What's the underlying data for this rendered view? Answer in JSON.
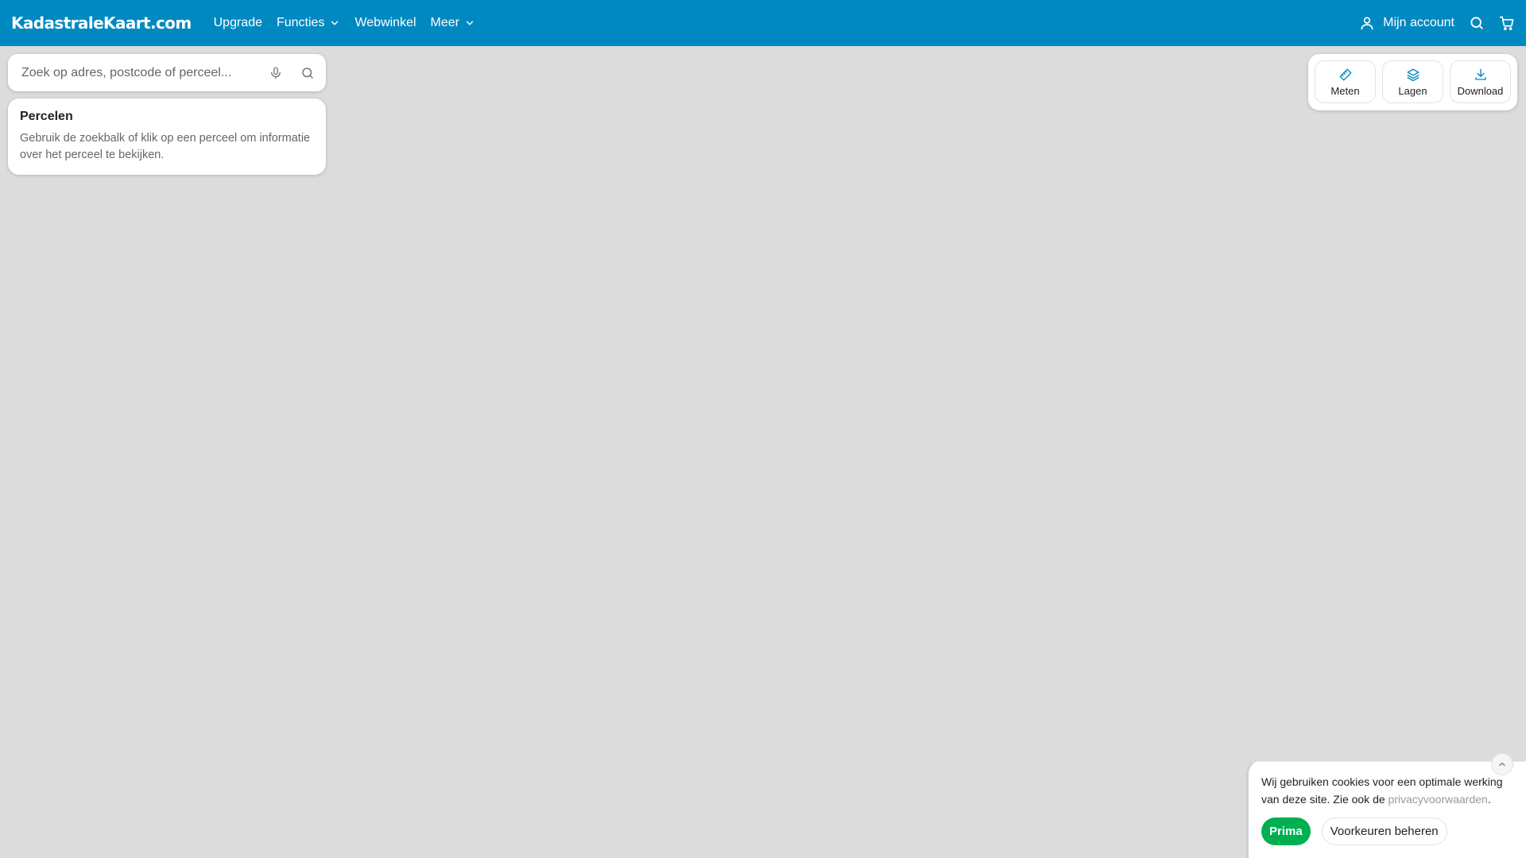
{
  "header": {
    "logo": "KadastraleKaart.com",
    "nav": {
      "upgrade": "Upgrade",
      "functies": "Functies",
      "webwinkel": "Webwinkel",
      "meer": "Meer"
    },
    "account_label": "Mijn account",
    "icons": [
      "user-icon",
      "search-icon",
      "cart-icon",
      "chevron-down-icon"
    ]
  },
  "search": {
    "placeholder": "Zoek op adres, postcode of perceel...",
    "value": ""
  },
  "info_card": {
    "title": "Percelen",
    "text": "Gebruik de zoekbalk of klik op een perceel om informatie over het perceel te bekijken."
  },
  "tools": {
    "meten": "Meten",
    "lagen": "Lagen",
    "download": "Download"
  },
  "cookie": {
    "text_before": "Wij gebruiken cookies voor een optimale werking van deze site. Zie ook de ",
    "link": "privacyvoorwaarden",
    "text_after": ".",
    "accept": "Prima",
    "preferences": "Voorkeuren beheren"
  },
  "colors": {
    "header": "#0089c0",
    "map_background": "#dcdcdc",
    "accept_button": "#00b050",
    "tool_icon": "#0089c0"
  }
}
